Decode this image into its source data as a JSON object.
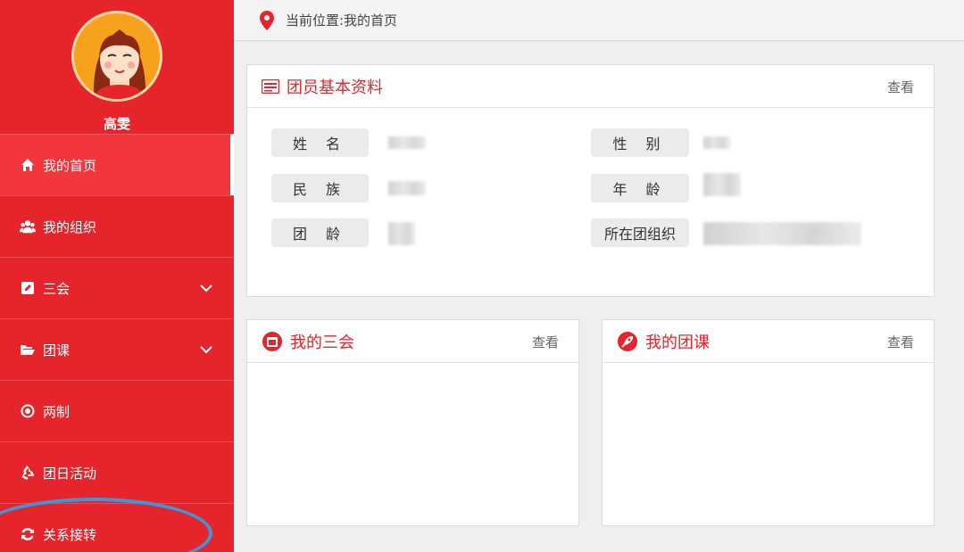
{
  "user": {
    "name": "高雯"
  },
  "sidebar": {
    "items": [
      {
        "label": "我的首页",
        "icon": "home-icon"
      },
      {
        "label": "我的组织",
        "icon": "users-icon"
      },
      {
        "label": "三会",
        "icon": "edit-icon"
      },
      {
        "label": "团课",
        "icon": "folder-open-icon"
      },
      {
        "label": "两制",
        "icon": "target-icon"
      },
      {
        "label": "团日活动",
        "icon": "recycle-icon"
      },
      {
        "label": "关系接转",
        "icon": "refresh-icon"
      }
    ]
  },
  "topbar": {
    "breadcrumb": "当前位置:我的首页"
  },
  "profile_panel": {
    "title": "团员基本资料",
    "view_label": "查看",
    "fields": [
      {
        "label": "姓 名"
      },
      {
        "label": "性 别"
      },
      {
        "label": "民 族"
      },
      {
        "label": "年 龄"
      },
      {
        "label": "团 龄"
      },
      {
        "label": "所在团组织"
      }
    ]
  },
  "meetings_panel": {
    "title": "我的三会",
    "view_label": "查看"
  },
  "courses_panel": {
    "title": "我的团课",
    "view_label": "查看"
  },
  "colors": {
    "brand_red": "#e5242b",
    "active_red": "#f1363e",
    "highlight_blue": "#3b97dc"
  }
}
